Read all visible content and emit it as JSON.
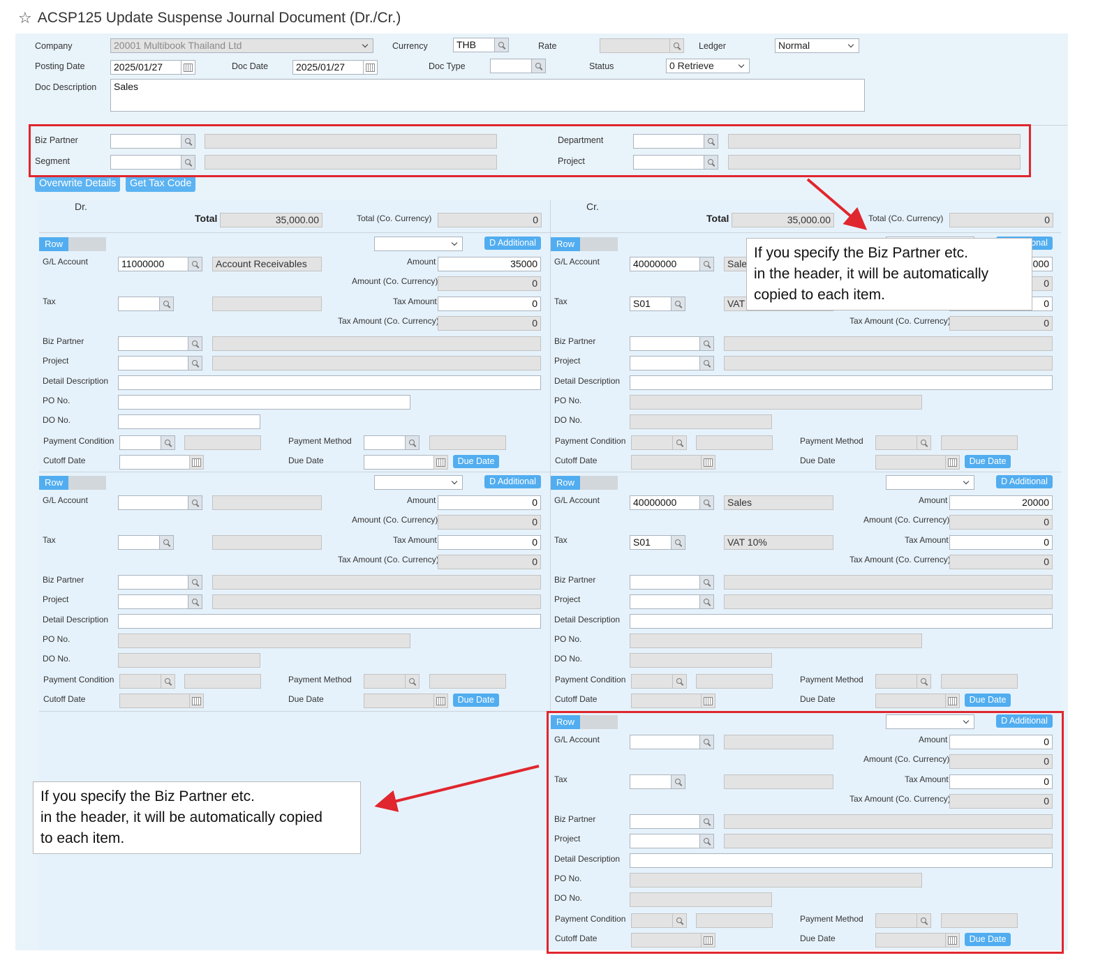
{
  "window": {
    "title": "ACSP125 Update Suspense Journal Document (Dr./Cr.)"
  },
  "header": {
    "company_label": "Company",
    "company_value": "20001 Multibook Thailand Ltd",
    "currency_label": "Currency",
    "currency_value": "THB",
    "rate_label": "Rate",
    "rate_value": "",
    "ledger_label": "Ledger",
    "ledger_value": "Normal",
    "posting_date_label": "Posting Date",
    "posting_date_value": "2025/01/27",
    "doc_date_label": "Doc Date",
    "doc_date_value": "2025/01/27",
    "doc_type_label": "Doc Type",
    "doc_type_value": "",
    "status_label": "Status",
    "status_value": "0 Retrieve",
    "doc_description_label": "Doc Description",
    "doc_description_value": "Sales"
  },
  "defaults": {
    "biz_partner_label": "Biz Partner",
    "segment_label": "Segment",
    "department_label": "Department",
    "project_label": "Project"
  },
  "actions": {
    "overwrite_details": "Overwrite Details",
    "get_tax_code": "Get Tax Code"
  },
  "labels": {
    "row": "Row",
    "d_additional": "D Additional",
    "gl_account": "G/L Account",
    "tax": "Tax",
    "amount": "Amount",
    "amount_co": "Amount (Co. Currency)",
    "tax_amount": "Tax Amount",
    "tax_amount_co": "Tax Amount (Co. Currency)",
    "biz_partner": "Biz Partner",
    "project": "Project",
    "detail_description": "Detail Description",
    "po_no": "PO No.",
    "do_no": "DO No.",
    "payment_condition": "Payment Condition",
    "payment_method": "Payment Method",
    "cutoff_date": "Cutoff Date",
    "due_date_label": "Due Date",
    "due_date_btn": "Due Date",
    "total": "Total",
    "total_co": "Total (Co. Currency)"
  },
  "debit": {
    "heading": "Dr.",
    "total": "35,000.00",
    "total_co": "0",
    "rows": [
      {
        "gl_account": "11000000",
        "gl_name": "Account Receivables",
        "tax": "",
        "tax_name": "",
        "amount": "35000",
        "amount_co": "0",
        "tax_amount": "0",
        "tax_amount_co": "0"
      },
      {
        "gl_account": "",
        "gl_name": "",
        "tax": "",
        "tax_name": "",
        "amount": "0",
        "amount_co": "0",
        "tax_amount": "0",
        "tax_amount_co": "0"
      }
    ]
  },
  "credit": {
    "heading": "Cr.",
    "total": "35,000.00",
    "total_co": "0",
    "rows": [
      {
        "gl_account": "40000000",
        "gl_name": "Sale",
        "tax": "S01",
        "tax_name": "VAT",
        "amount": "5000",
        "amount_co": "0",
        "tax_amount": "0",
        "tax_amount_co": "0"
      },
      {
        "gl_account": "40000000",
        "gl_name": "Sales",
        "tax": "S01",
        "tax_name": "VAT 10%",
        "amount": "20000",
        "amount_co": "0",
        "tax_amount": "0",
        "tax_amount_co": "0"
      },
      {
        "gl_account": "",
        "gl_name": "",
        "tax": "",
        "tax_name": "",
        "amount": "0",
        "amount_co": "0",
        "tax_amount": "0",
        "tax_amount_co": "0"
      }
    ]
  },
  "annotations": {
    "note_top": "If you specify the Biz Partner etc.\nin the header, it will be automatically\ncopied to each item.",
    "note_bottom": "If you specify the Biz Partner etc.\nin the header, it will be automatically copied\nto each item."
  },
  "colors": {
    "accent": "#51adf0",
    "annotation_red": "#e0262e",
    "form_background": "#e9f3fa"
  }
}
